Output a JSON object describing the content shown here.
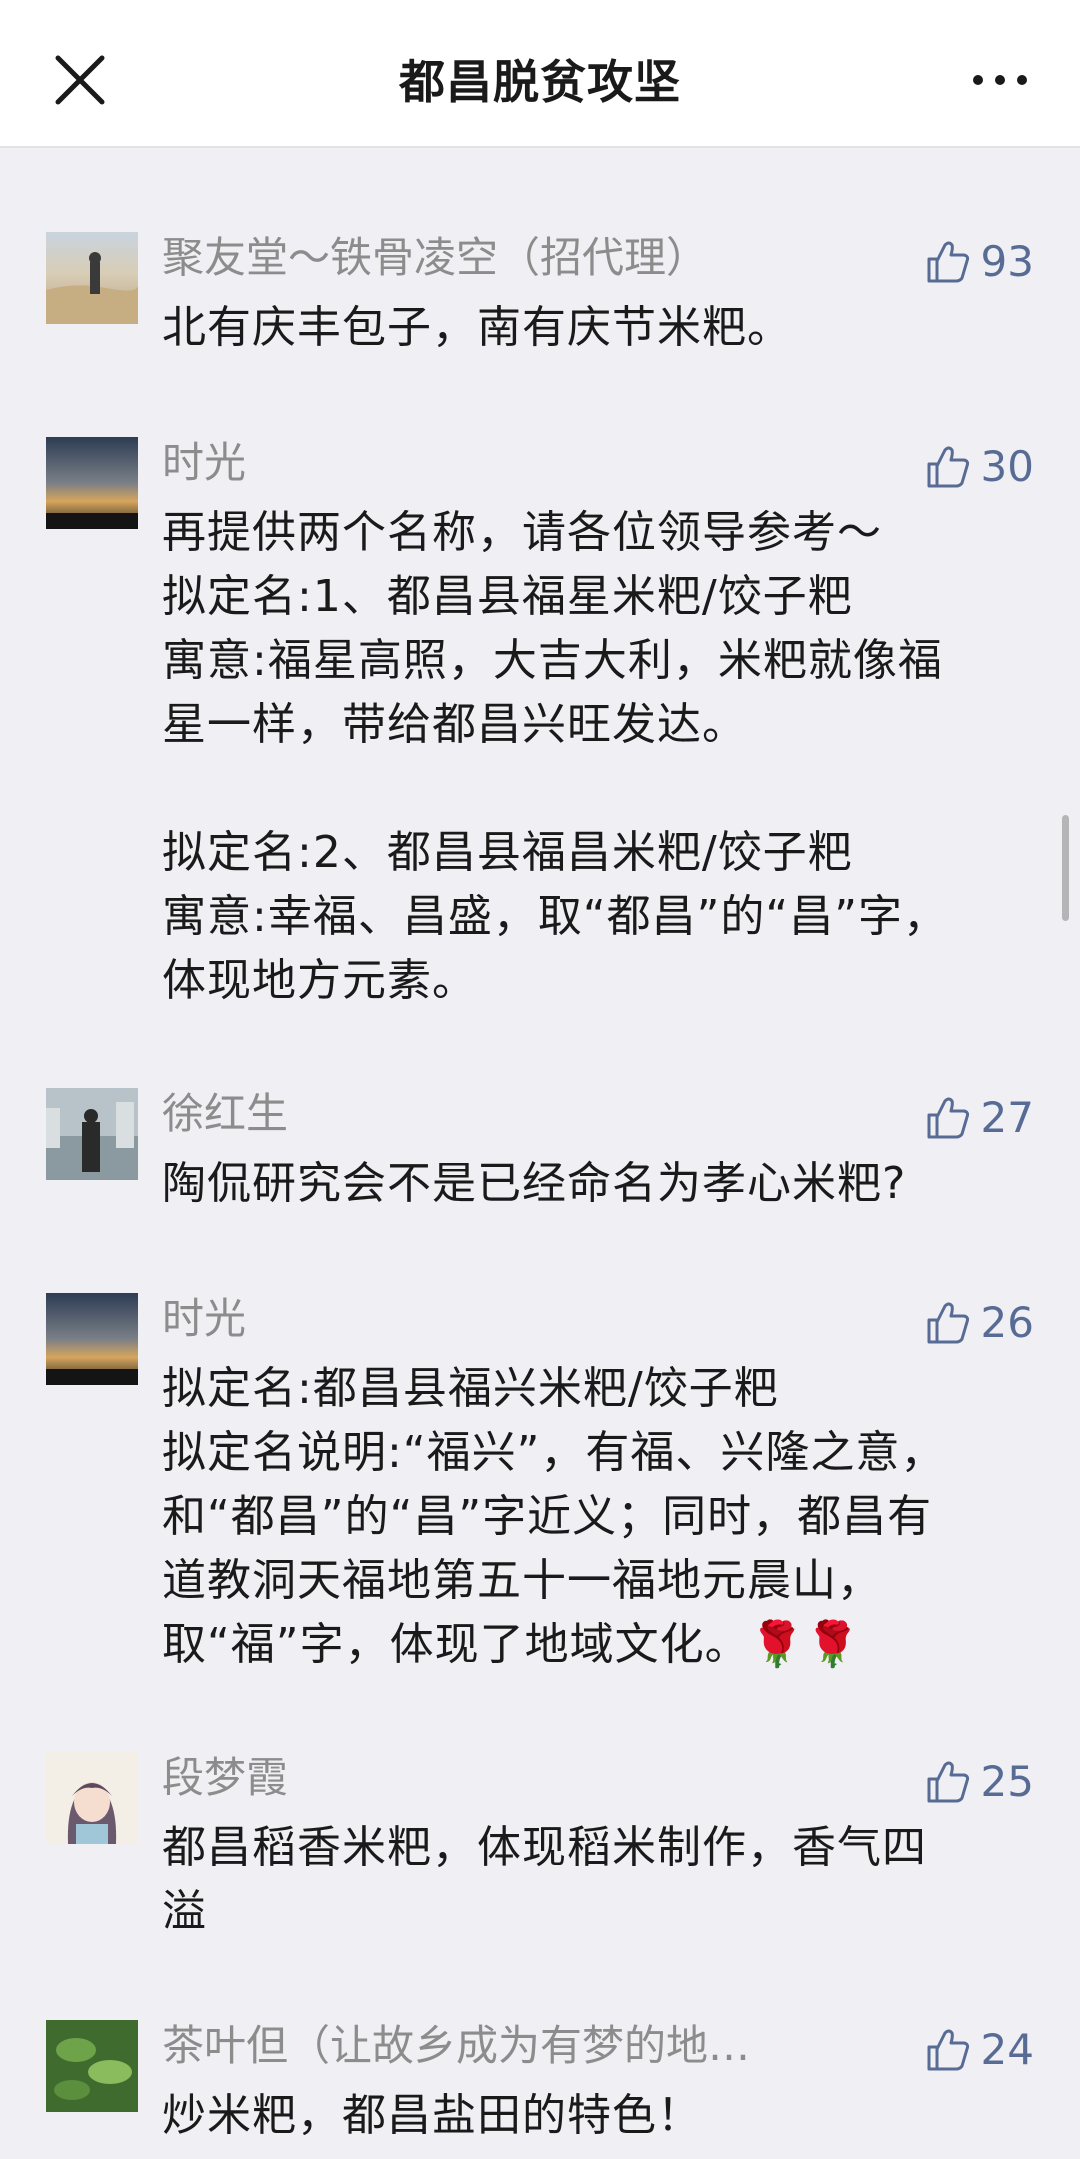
{
  "nav": {
    "title": "都昌脱贫攻坚",
    "close_icon": "close-icon",
    "more_icon": "more-icon"
  },
  "comments": [
    {
      "author": "聚友堂～铁骨凌空（招代理）",
      "likes": "93",
      "text": "北有庆丰包子，南有庆节米粑。"
    },
    {
      "author": "时光",
      "likes": "30",
      "text": "再提供两个名称，请各位领导参考～\n拟定名:1、都昌县福星米粑/饺子粑\n寓意:福星高照，大吉大利，米粑就像福\n星一样，带给都昌兴旺发达。\n\n拟定名:2、都昌县福昌米粑/饺子粑\n寓意:幸福、昌盛，取“都昌”的“昌”字，\n体现地方元素。"
    },
    {
      "author": "徐红生",
      "likes": "27",
      "text": "陶侃研究会不是已经命名为孝心米粑?"
    },
    {
      "author": "时光",
      "likes": "26",
      "text": "拟定名:都昌县福兴米粑/饺子粑\n拟定名说明:“福兴”，有福、兴隆之意，\n和“都昌”的“昌”字近义；同时，都昌有\n道教洞天福地第五十一福地元晨山，\n取“福”字，体现了地域文化。🌹🌹"
    },
    {
      "author": "段梦霞",
      "likes": "25",
      "text": "都昌稻香米粑，体现稻米制作，香气四\n溢"
    },
    {
      "author": "茶叶但（让故乡成为有梦的地…",
      "likes": "24",
      "text": "炒米粑，都昌盐田的特色！"
    }
  ]
}
